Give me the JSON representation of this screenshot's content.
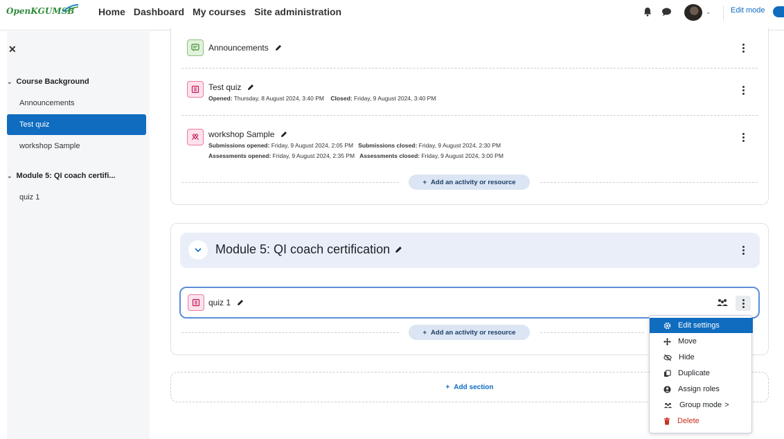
{
  "navbar": {
    "logo": "OpenKGUMSB",
    "links": [
      "Home",
      "Dashboard",
      "My courses",
      "Site administration"
    ],
    "edit_mode_label": "Edit mode"
  },
  "sidebar": {
    "sections": [
      {
        "title": "Course Background",
        "items": [
          "Announcements",
          "Test quiz",
          "workshop Sample"
        ],
        "active_index": 1
      },
      {
        "title": "Module 5: QI coach certifi...",
        "items": [
          "quiz 1"
        ]
      }
    ]
  },
  "section1": {
    "activities": [
      {
        "title": "Announcements",
        "icon": "forum-icon"
      },
      {
        "title": "Test quiz",
        "icon": "quiz-icon",
        "dates": [
          {
            "label": "Opened:",
            "value": "Thursday, 8 August 2024, 3:40 PM"
          },
          {
            "label": "Closed:",
            "value": "Friday, 9 August 2024, 3:40 PM"
          }
        ]
      },
      {
        "title": "workshop Sample",
        "icon": "workshop-icon",
        "dates": [
          {
            "label": "Submissions opened:",
            "value": "Friday, 9 August 2024, 2:05 PM"
          },
          {
            "label": "Submissions closed:",
            "value": "Friday, 9 August 2024, 2:30 PM"
          }
        ],
        "dates2": [
          {
            "label": "Assessments opened:",
            "value": "Friday, 9 August 2024, 2:35 PM"
          },
          {
            "label": "Assessments closed:",
            "value": "Friday, 9 August 2024, 3:00 PM"
          }
        ]
      }
    ],
    "add_label": "Add an activity or resource"
  },
  "module5": {
    "title": "Module 5: QI coach certification",
    "activity": "quiz 1",
    "add_label": "Add an activity or resource"
  },
  "add_section_label": "Add section",
  "menu": {
    "items": [
      "Edit settings",
      "Move",
      "Hide",
      "Duplicate",
      "Assign roles",
      "Group mode",
      "Delete"
    ],
    "group_mode_suffix": ">"
  },
  "colors": {
    "primary": "#0f6cbf",
    "danger": "#ca3120",
    "module_bg": "#e9eef8"
  }
}
